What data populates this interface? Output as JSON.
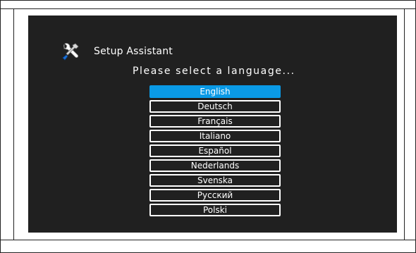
{
  "title": "Setup Assistant",
  "prompt": "Please select a language...",
  "header_icon": "tools-icon",
  "colors": {
    "screen_bg": "#202020",
    "selection": "#0a9ae6",
    "text": "#ffffff"
  },
  "languages": [
    {
      "label": "English",
      "selected": true
    },
    {
      "label": "Deutsch",
      "selected": false
    },
    {
      "label": "Français",
      "selected": false
    },
    {
      "label": "Italiano",
      "selected": false
    },
    {
      "label": "Español",
      "selected": false
    },
    {
      "label": "Nederlands",
      "selected": false
    },
    {
      "label": "Svenska",
      "selected": false
    },
    {
      "label": "Русский",
      "selected": false
    },
    {
      "label": "Polski",
      "selected": false
    }
  ]
}
